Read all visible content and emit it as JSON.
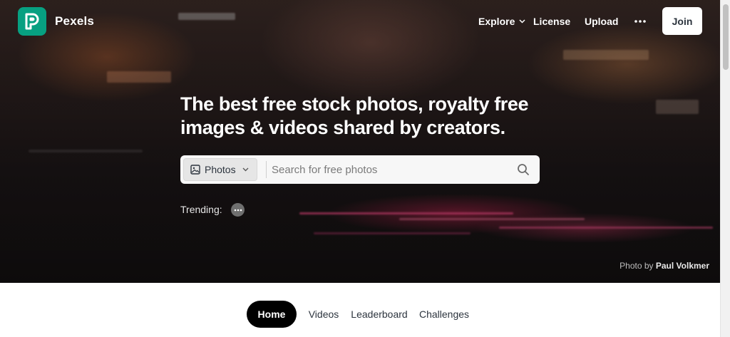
{
  "brand": {
    "name": "Pexels",
    "accent_color": "#07a081"
  },
  "nav": {
    "explore": "Explore",
    "license": "License",
    "upload": "Upload",
    "more_icon": "more-horizontal-icon",
    "join": "Join"
  },
  "hero": {
    "headline_line1": "The best free stock photos, royalty free",
    "headline_line2": "images & videos shared by creators.",
    "search": {
      "type_selected": "Photos",
      "type_icon": "image-icon",
      "placeholder": "Search for free photos",
      "value": ""
    },
    "trending_label": "Trending:",
    "credit_prefix": "Photo by",
    "credit_author": "Paul Volkmer"
  },
  "tabs": [
    {
      "label": "Home",
      "active": true
    },
    {
      "label": "Videos",
      "active": false
    },
    {
      "label": "Leaderboard",
      "active": false
    },
    {
      "label": "Challenges",
      "active": false
    }
  ]
}
